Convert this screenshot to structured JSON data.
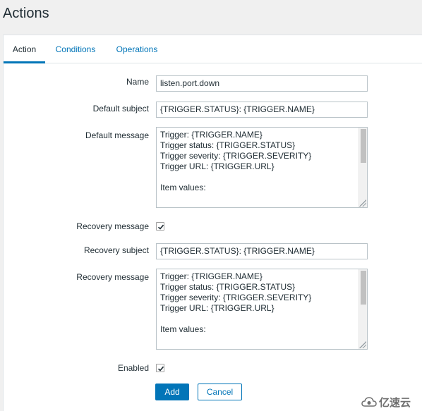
{
  "page": {
    "title": "Actions"
  },
  "tabs": [
    {
      "label": "Action",
      "active": true
    },
    {
      "label": "Conditions",
      "active": false
    },
    {
      "label": "Operations",
      "active": false
    }
  ],
  "form": {
    "name": {
      "label": "Name",
      "value": "listen.port.down"
    },
    "default_subject": {
      "label": "Default subject",
      "value": "{TRIGGER.STATUS}: {TRIGGER.NAME}"
    },
    "default_message": {
      "label": "Default message",
      "lines": [
        "Trigger: {TRIGGER.NAME}",
        "Trigger status: {TRIGGER.STATUS}",
        "Trigger severity: {TRIGGER.SEVERITY}",
        "Trigger URL: {TRIGGER.URL}",
        "",
        "Item values:",
        ""
      ]
    },
    "recovery_message_toggle": {
      "label": "Recovery message",
      "checked": true
    },
    "recovery_subject": {
      "label": "Recovery subject",
      "value": "{TRIGGER.STATUS}: {TRIGGER.NAME}"
    },
    "recovery_message": {
      "label": "Recovery message",
      "lines": [
        "Trigger: {TRIGGER.NAME}",
        "Trigger status: {TRIGGER.STATUS}",
        "Trigger severity: {TRIGGER.SEVERITY}",
        "Trigger URL: {TRIGGER.URL}",
        "",
        "Item values:",
        ""
      ]
    },
    "enabled": {
      "label": "Enabled",
      "checked": true
    }
  },
  "buttons": {
    "add": "Add",
    "cancel": "Cancel"
  },
  "watermark": {
    "text": "亿速云",
    "icon": "cloud-logo-icon"
  },
  "colors": {
    "accent": "#0275b8",
    "text": "#1f2c33",
    "border": "#b8c2c7",
    "background": "#f0f0f0"
  }
}
